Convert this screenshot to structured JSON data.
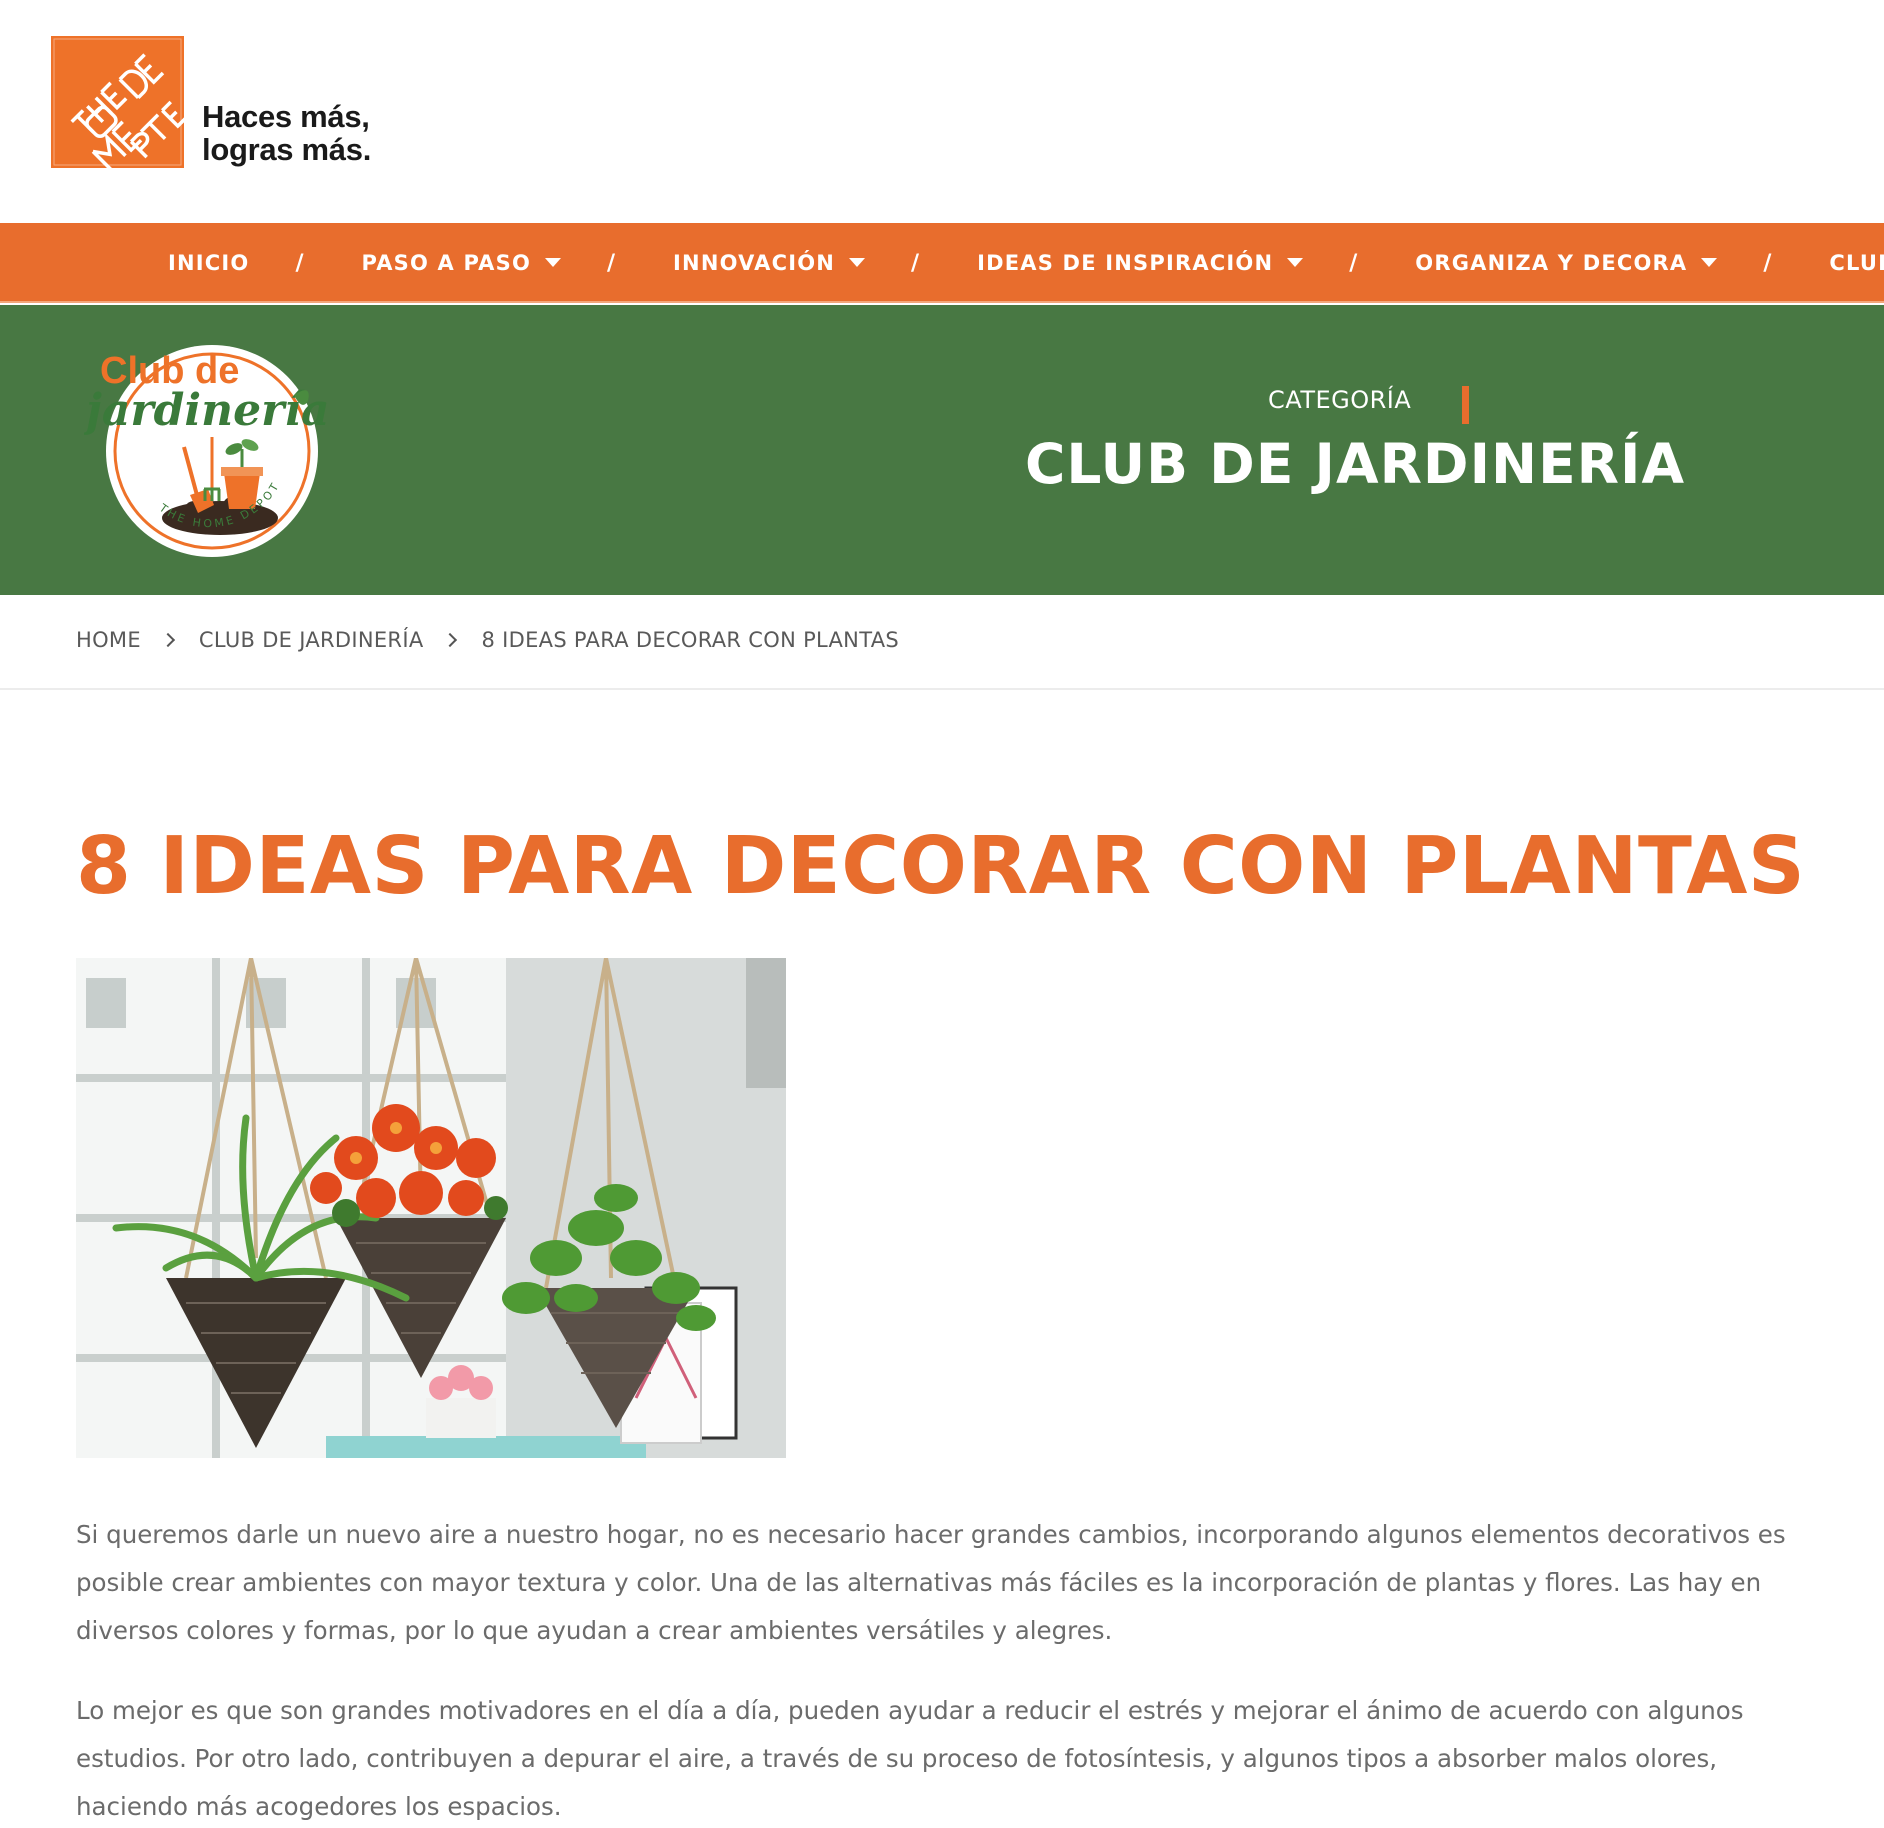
{
  "header": {
    "logo_alt": "THE HOME DEPOT",
    "tagline_line1": "Haces más,",
    "tagline_line2": "logras más."
  },
  "nav": {
    "items": [
      {
        "label": "INICIO",
        "has_dropdown": false
      },
      {
        "label": "PASO A PASO",
        "has_dropdown": true
      },
      {
        "label": "INNOVACIÓN",
        "has_dropdown": true
      },
      {
        "label": "IDEAS DE INSPIRACIÓN",
        "has_dropdown": true
      },
      {
        "label": "ORGANIZA Y DECORA",
        "has_dropdown": true
      },
      {
        "label": "CLUB",
        "has_dropdown": false
      }
    ],
    "separator": "/"
  },
  "banner": {
    "logo_text_top": "Club de",
    "logo_text_script": "jardinería",
    "logo_ring_text": "THE HOME DEPOT",
    "category_label": "CATEGORÍA",
    "category_title": "CLUB DE JARDINERÍA"
  },
  "breadcrumb": {
    "items": [
      "HOME",
      "CLUB DE JARDINERÍA",
      "8 IDEAS PARA DECORAR CON PLANTAS"
    ]
  },
  "article": {
    "title": "8 IDEAS PARA DECORAR CON PLANTAS",
    "paragraphs": [
      "Si queremos darle un nuevo aire a nuestro hogar, no es necesario hacer grandes cambios, incorporando algunos elementos decorativos es posible crear ambientes con mayor textura y color. Una de las alternativas más fáciles es la incorporación de plantas y flores. Las hay en diversos colores y formas, por lo que ayudan a crear ambientes versátiles y alegres.",
      "Lo mejor es que son grandes motivadores en el día a día, pueden ayudar a reducir el estrés y mejorar el ánimo de acuerdo con algunos estudios. Por otro lado, contribuyen a depurar el aire, a través de su proceso de fotosíntesis, y algunos tipos a absorber malos olores, haciendo más acogedores los espacios."
    ]
  },
  "colors": {
    "brand_orange": "#e86d2d",
    "banner_green": "#487843",
    "body_text": "#6b6b6b"
  }
}
